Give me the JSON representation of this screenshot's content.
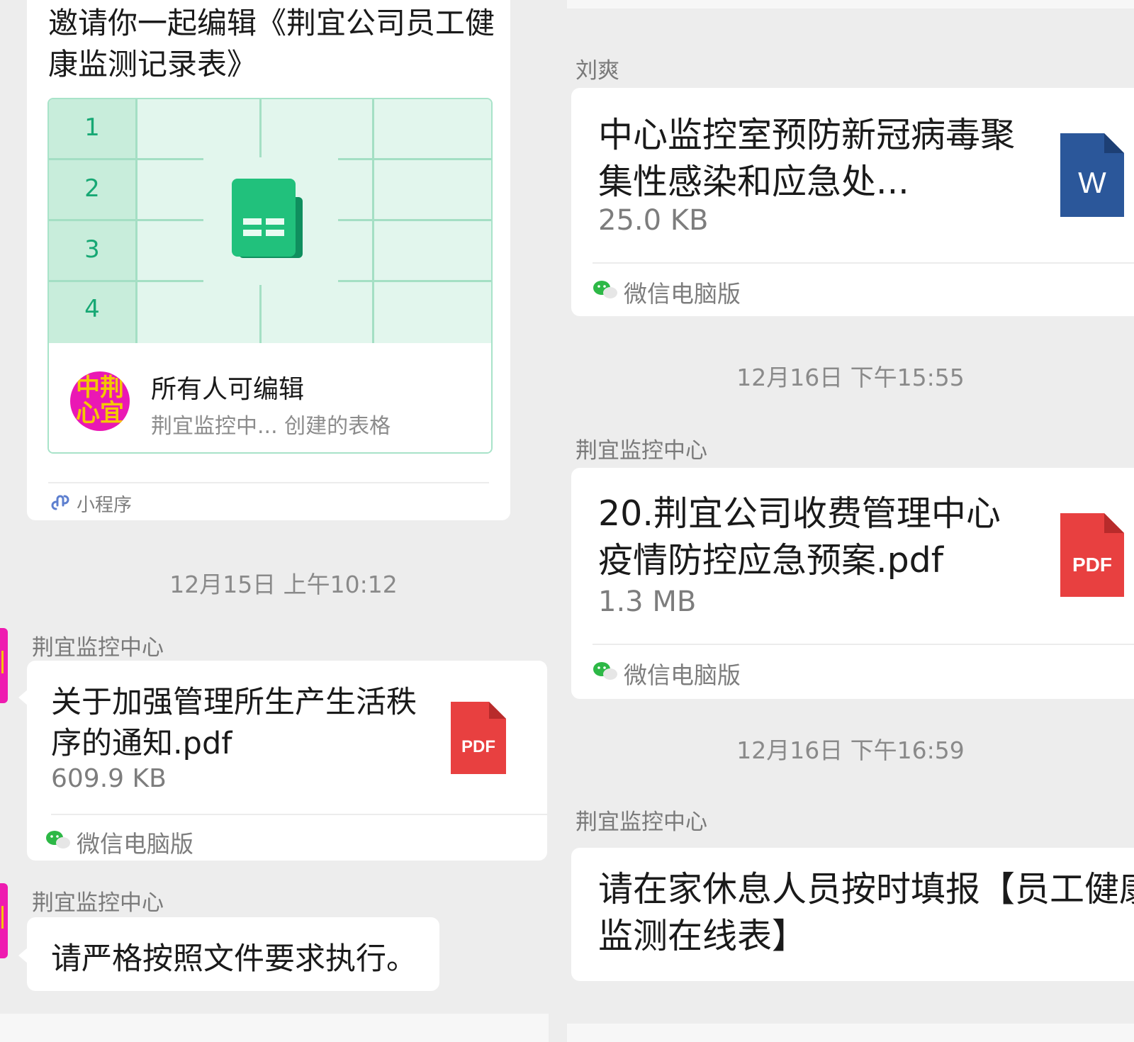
{
  "left": {
    "mini_program": {
      "title": "邀请你一起编辑《荆宜公司员工健康监测记录表》",
      "row_numbers": [
        "1",
        "2",
        "3",
        "4"
      ],
      "edit_status": "所有人可编辑",
      "creator": "荆宜监控中... 创建的表格",
      "avatar_text": [
        "中荆",
        "心宜"
      ],
      "source_label": "小程序"
    },
    "timestamp_1": "12月15日 上午10:12",
    "message_1": {
      "sender": "荆宜监控中心",
      "file_name": "关于加强管理所生产生活秩序的通知.pdf",
      "file_size": "609.9 KB",
      "file_type": "PDF",
      "source": "微信电脑版"
    },
    "message_2": {
      "sender": "荆宜监控中心",
      "text": "请严格按照文件要求执行。"
    }
  },
  "right": {
    "message_1": {
      "sender": "刘爽",
      "file_name": "中心监控室预防新冠病毒聚集性感染和应急处...",
      "file_size": "25.0 KB",
      "file_type": "W",
      "source": "微信电脑版"
    },
    "timestamp_2": "12月16日 下午15:55",
    "message_2": {
      "sender": "荆宜监控中心",
      "file_name": "20.荆宜公司收费管理中心疫情防控应急预案.pdf",
      "file_size": "1.3 MB",
      "file_type": "PDF",
      "source": "微信电脑版"
    },
    "timestamp_3": "12月16日 下午16:59",
    "message_3": {
      "sender": "荆宜监控中心",
      "text": "请在家休息人员按时填报【员工健康监测在线表】"
    }
  },
  "colors": {
    "background": "#ededed",
    "bubble": "#ffffff",
    "sheet_green": "#17a874",
    "pdf_red": "#e84040",
    "word_blue": "#2b579a",
    "avatar_magenta": "#ea18b4"
  },
  "icons": [
    "spreadsheet-icon",
    "mini-program-link-icon",
    "pdf-file-icon",
    "word-file-icon",
    "wechat-icon"
  ]
}
